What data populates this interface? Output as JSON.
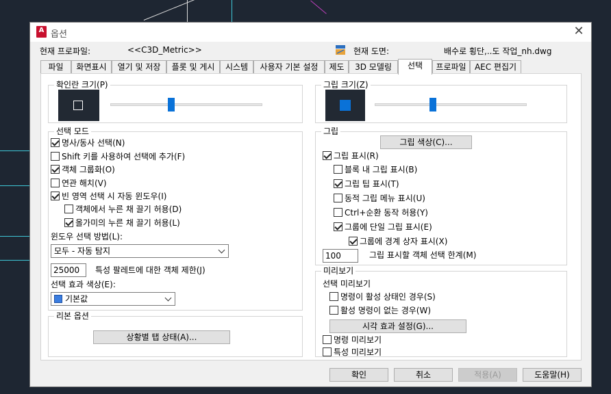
{
  "dialog": {
    "title": "옵션",
    "close_symbol": "✕",
    "app_icon_letter": "A"
  },
  "header": {
    "profile_label": "현재 프로파일:",
    "profile_value": "<<C3D_Metric>>",
    "drawing_label": "현재 도면:",
    "drawing_value": "배수로 횡단,..도 작업_nh.dwg"
  },
  "tabs": [
    {
      "label": "파일"
    },
    {
      "label": "화면표시"
    },
    {
      "label": "열기 및 저장"
    },
    {
      "label": "플롯 및 게시"
    },
    {
      "label": "시스템"
    },
    {
      "label": "사용자 기본 설정"
    },
    {
      "label": "제도"
    },
    {
      "label": "3D 모델링"
    },
    {
      "label": "선택"
    },
    {
      "label": "프로파일"
    },
    {
      "label": "AEC 편집기"
    }
  ],
  "pickbox": {
    "legend": "확인란 크기(P)",
    "level": 0.45
  },
  "selection_modes": {
    "legend": "선택 모드",
    "options": [
      {
        "label": "명사/동사 선택(N)",
        "checked": true
      },
      {
        "label": "Shift 키를 사용하여 선택에 추가(F)",
        "checked": false
      },
      {
        "label": "객체 그룹화(O)",
        "checked": true
      },
      {
        "label": "연관 해치(V)",
        "checked": false
      },
      {
        "label": "빈 영역 선택 시 자동 윈도우(I)",
        "checked": true
      },
      {
        "label": "객체에서 누른 채 끌기 허용(D)",
        "checked": false
      },
      {
        "label": "올가미의 누른 채 끌기 허용(L)",
        "checked": true
      }
    ],
    "window_method_label": "윈도우 선택 방법(L):",
    "window_method_value": "모두 - 자동 탐지",
    "limit_value": "25000",
    "limit_label": "특성 팔레트에 대한 객체 제한(J)",
    "effect_color_label": "선택 효과 색상(E):",
    "effect_color_value": "기본값",
    "effect_color_swatch": "#3a7de0"
  },
  "ribbon": {
    "legend": "리본 옵션",
    "button": "상황별 탭 상태(A)..."
  },
  "gripsize": {
    "legend": "그립 크기(Z)",
    "level": 0.5,
    "grip_color": "#0a72d8"
  },
  "grips": {
    "legend": "그립",
    "color_button": "그립 색상(C)...",
    "options": [
      {
        "label": "그립 표시(R)",
        "checked": true
      },
      {
        "label": "블록 내 그립 표시(B)",
        "checked": false
      },
      {
        "label": "그립 팁 표시(T)",
        "checked": true
      },
      {
        "label": "동적 그립 메뉴 표시(U)",
        "checked": false
      },
      {
        "label": "Ctrl+순환 동작 허용(Y)",
        "checked": false
      },
      {
        "label": "그룹에 단일 그립 표시(E)",
        "checked": true
      },
      {
        "label": "그룹에 경계 상자 표시(X)",
        "checked": true
      }
    ],
    "limit_value": "100",
    "limit_label": "그립 표시할 객체 선택 한계(M)"
  },
  "preview": {
    "legend": "미리보기",
    "sub_label": "선택 미리보기",
    "options": [
      {
        "label": "명령이 활성 상태인 경우(S)",
        "checked": false
      },
      {
        "label": "활성 명령이 없는 경우(W)",
        "checked": false
      }
    ],
    "visual_button": "시각 효과 설정(G)...",
    "bottom_options": [
      {
        "label": "명령 미리보기",
        "checked": false
      },
      {
        "label": "특성 미리보기",
        "checked": false
      }
    ]
  },
  "footer": {
    "ok": "확인",
    "cancel": "취소",
    "apply": "적용(A)",
    "help": "도움말(H)"
  }
}
